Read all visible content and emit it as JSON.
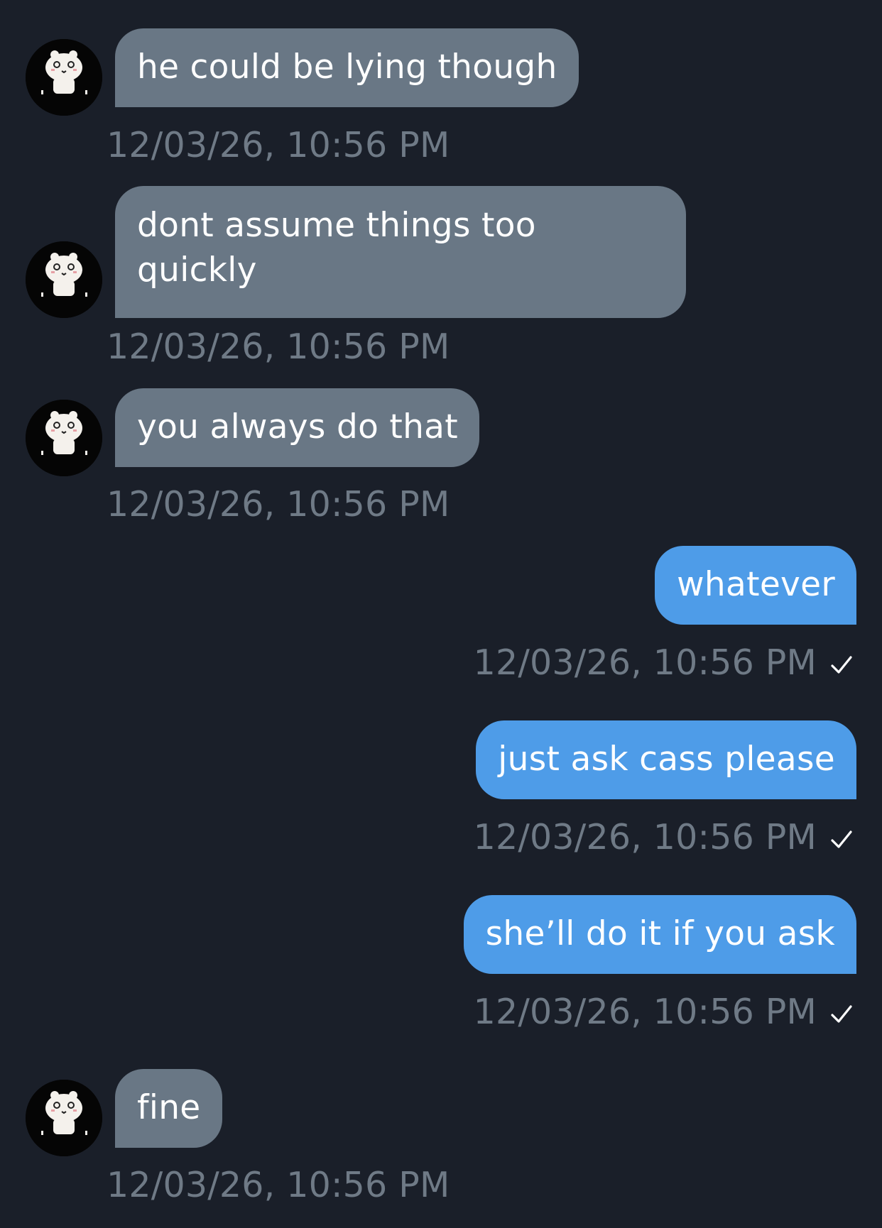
{
  "colors": {
    "background": "#1a1f29",
    "incoming_bubble": "#697785",
    "outgoing_bubble": "#4e9ce8",
    "timestamp": "#6f7a86",
    "text": "#ffffff"
  },
  "messages": [
    {
      "direction": "incoming",
      "text": "he could be lying though",
      "time": "12/03/26, 10:56 PM",
      "avatar": "panda-sticker-icon"
    },
    {
      "direction": "incoming",
      "text": "dont assume things too quickly",
      "time": "12/03/26, 10:56 PM",
      "avatar": "panda-sticker-icon"
    },
    {
      "direction": "incoming",
      "text": "you always do that",
      "time": "12/03/26, 10:56 PM",
      "avatar": "panda-sticker-icon"
    },
    {
      "direction": "outgoing",
      "text": "whatever",
      "time": "12/03/26, 10:56 PM",
      "status_icon": "checkmark-icon"
    },
    {
      "direction": "outgoing",
      "text": "just ask cass please",
      "time": "12/03/26, 10:56 PM",
      "status_icon": "checkmark-icon"
    },
    {
      "direction": "outgoing",
      "text": "she’ll do it if you ask",
      "time": "12/03/26, 10:56 PM",
      "status_icon": "checkmark-icon"
    },
    {
      "direction": "incoming",
      "text": "fine",
      "time": "12/03/26, 10:56 PM",
      "avatar": "panda-sticker-icon"
    }
  ]
}
